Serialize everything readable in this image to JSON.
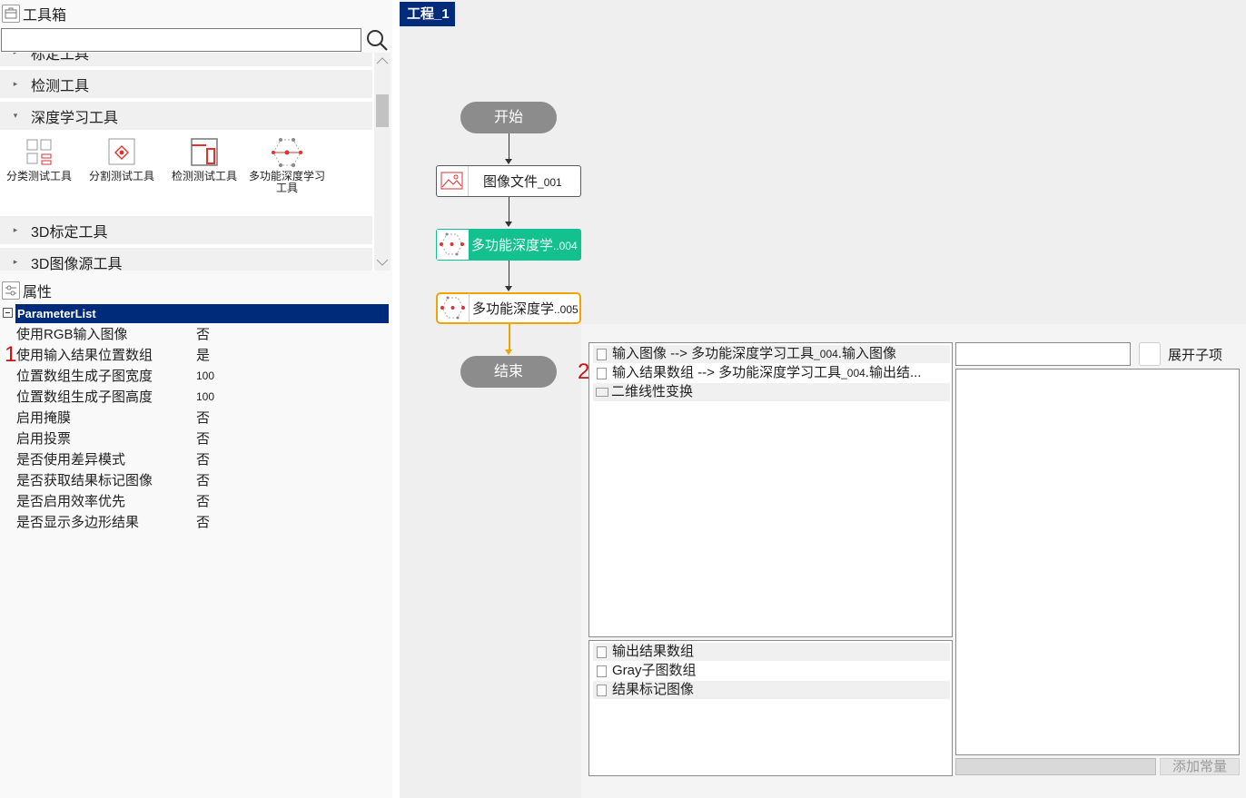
{
  "toolbox": {
    "title": "工具箱",
    "search_value": "",
    "categories": [
      {
        "label": "标定工具"
      },
      {
        "label": "检测工具"
      },
      {
        "label": "深度学习工具"
      },
      {
        "label": "3D标定工具"
      },
      {
        "label": "3D图像源工具"
      }
    ],
    "tools": [
      {
        "label": "分类测试工具",
        "icon": "classify-test-icon"
      },
      {
        "label": "分割测试工具",
        "icon": "segment-test-icon"
      },
      {
        "label": "检测测试工具",
        "icon": "detect-test-icon"
      },
      {
        "label": "多功能深度学习工具",
        "icon": "multi-dl-icon"
      }
    ]
  },
  "properties": {
    "title": "属性",
    "header": "ParameterList",
    "rows": [
      {
        "name": "使用RGB输入图像",
        "value": "否"
      },
      {
        "name": "使用输入结果位置数组",
        "value": "是"
      },
      {
        "name": "位置数组生成子图宽度",
        "value": "100"
      },
      {
        "name": "位置数组生成子图高度",
        "value": "100"
      },
      {
        "name": "启用掩膜",
        "value": "否"
      },
      {
        "name": "启用投票",
        "value": "否"
      },
      {
        "name": "是否使用差异模式",
        "value": "否"
      },
      {
        "name": "是否获取结果标记图像",
        "value": "否"
      },
      {
        "name": "是否启用效率优先",
        "value": "否"
      },
      {
        "name": "是否显示多边形结果",
        "value": "否"
      }
    ],
    "annotation": "1"
  },
  "project": {
    "tab_label": "工程_1",
    "start_label": "开始",
    "end_label": "结束",
    "nodes": [
      {
        "name": "图像文件",
        "suffix": "_001"
      },
      {
        "name": "多功能深度学",
        "suffix": "..004"
      },
      {
        "name": "多功能深度学",
        "suffix": "..005"
      }
    ]
  },
  "dialog": {
    "annotation": "2",
    "inputs": [
      {
        "main": "输入图像  -->  多功能深度学习工具",
        "suffix": "_004",
        "tail": ".输入图像"
      },
      {
        "main": "输入结果数组  -->  多功能深度学习工具",
        "suffix": "_004",
        "tail": ".输出结..."
      },
      {
        "main": "二维线性变换",
        "suffix": "",
        "tail": ""
      }
    ],
    "outputs": [
      {
        "label": "输出结果数组"
      },
      {
        "label": "Gray子图数组"
      },
      {
        "label": "结果标记图像"
      }
    ],
    "expand_label": "展开子项",
    "add_const_label": "添加常量",
    "right_input_value": ""
  },
  "colors": {
    "accent": "#002a7a",
    "node_active": "#13c18f",
    "node_selected": "#f0a400",
    "terminal": "#8c8c8c",
    "annotation": "#d01010"
  }
}
